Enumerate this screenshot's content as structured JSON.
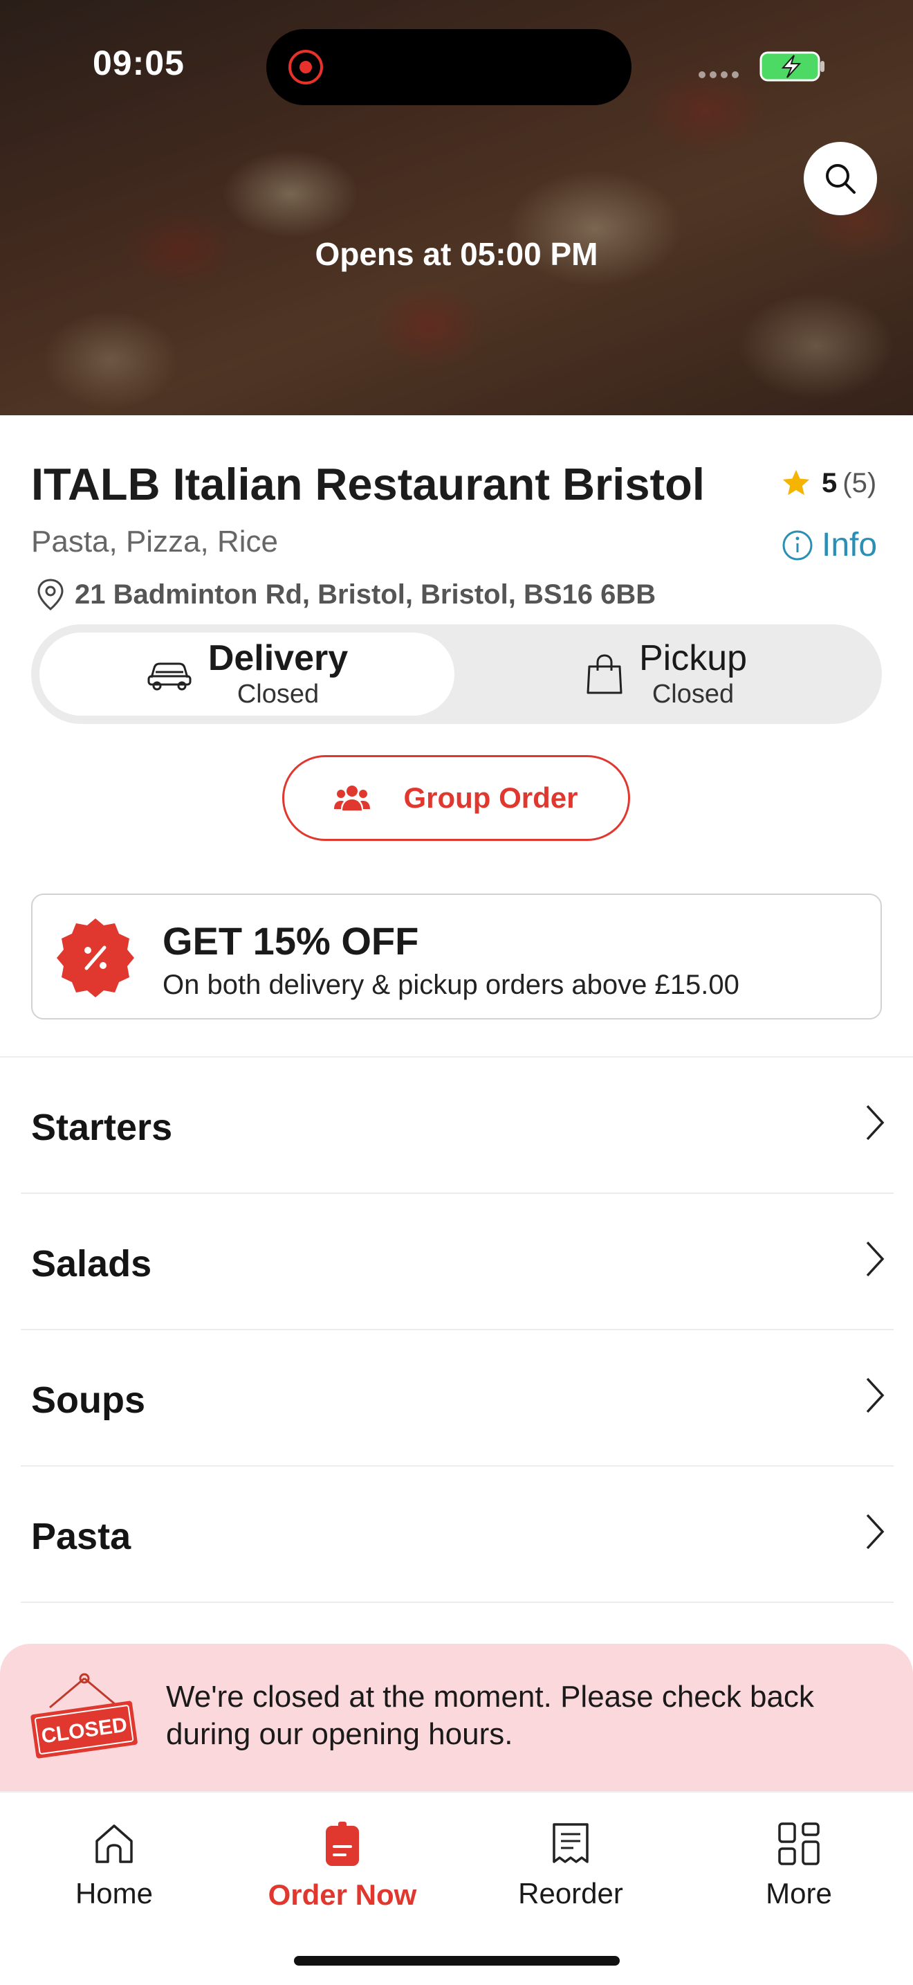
{
  "status_bar": {
    "time": "09:05"
  },
  "hero": {
    "opens_text": "Opens at 05:00 PM"
  },
  "restaurant": {
    "name": "ITALB Italian Restaurant Bristol",
    "rating_value": "5",
    "rating_count": "(5)",
    "cuisines": "Pasta, Pizza, Rice",
    "info_label": "Info",
    "address": "21 Badminton Rd, Bristol, Bristol, BS16 6BB"
  },
  "order_mode": {
    "selected": "Delivery",
    "options": [
      {
        "title": "Delivery",
        "status": "Closed",
        "icon": "car-icon"
      },
      {
        "title": "Pickup",
        "status": "Closed",
        "icon": "shopping-bag-icon"
      }
    ]
  },
  "group_order": {
    "label": "Group Order",
    "icon": "group-icon"
  },
  "promo": {
    "title": "GET 15% OFF",
    "subtitle": "On both delivery & pickup orders above £15.00",
    "icon": "discount-badge-icon"
  },
  "categories": [
    {
      "label": "Starters"
    },
    {
      "label": "Salads"
    },
    {
      "label": "Soups"
    },
    {
      "label": "Pasta"
    }
  ],
  "closed_banner": {
    "sign_text": "CLOSED",
    "message": "We're closed at the moment. Please check back during our opening hours."
  },
  "tabbar": {
    "active": "Order Now",
    "tabs": [
      {
        "label": "Home",
        "icon": "home-icon"
      },
      {
        "label": "Order Now",
        "icon": "order-icon"
      },
      {
        "label": "Reorder",
        "icon": "receipt-icon"
      },
      {
        "label": "More",
        "icon": "grid-icon"
      }
    ]
  },
  "colors": {
    "accent": "#e0382f",
    "info": "#2a8fb5",
    "star": "#f5b400",
    "closed_banner_bg": "#fbd8dc",
    "toggle_bg": "#ebebeb"
  }
}
